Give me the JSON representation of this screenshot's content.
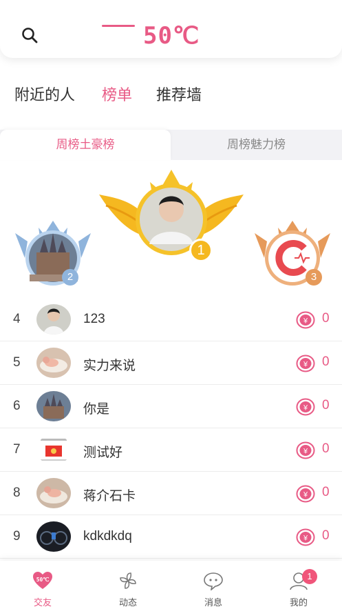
{
  "header": {
    "logo_text": "50℃"
  },
  "tabs": [
    {
      "label": "附近的人",
      "active": false
    },
    {
      "label": "榜单",
      "active": true
    },
    {
      "label": "推荐墙",
      "active": false
    }
  ],
  "subtabs": [
    {
      "label": "周榜土豪榜",
      "active": true
    },
    {
      "label": "周榜魅力榜",
      "active": false
    }
  ],
  "podium": [
    {
      "rank": "1",
      "avatar": "young man in white shirt"
    },
    {
      "rank": "2",
      "avatar": "castle"
    },
    {
      "rank": "3",
      "avatar": "red C logo"
    }
  ],
  "ranking": [
    {
      "rank": "4",
      "name": "123",
      "score": "0",
      "avatar": "young man"
    },
    {
      "rank": "5",
      "name": "实力来说",
      "score": "0",
      "avatar": "baby in bath"
    },
    {
      "rank": "6",
      "name": "你是",
      "score": "0",
      "avatar": "castle"
    },
    {
      "rank": "7",
      "name": "测试好",
      "score": "0",
      "avatar": "red envelope screenshot"
    },
    {
      "rank": "8",
      "name": "蒋介石卡",
      "score": "0",
      "avatar": "baby in bath"
    },
    {
      "rank": "9",
      "name": "kdkdkdq",
      "score": "0",
      "avatar": "car dashboard"
    }
  ],
  "bottom_nav": [
    {
      "label": "交友",
      "icon": "heart-icon",
      "active": true
    },
    {
      "label": "动态",
      "icon": "pinwheel-icon",
      "active": false
    },
    {
      "label": "消息",
      "icon": "chat-bubble-icon",
      "active": false
    },
    {
      "label": "我的",
      "icon": "person-icon",
      "active": false,
      "badge": "1"
    }
  ],
  "colors": {
    "accent": "#e85a85",
    "gold": "#f5b820",
    "silver": "#8fb4dc",
    "bronze": "#e69a5a"
  }
}
